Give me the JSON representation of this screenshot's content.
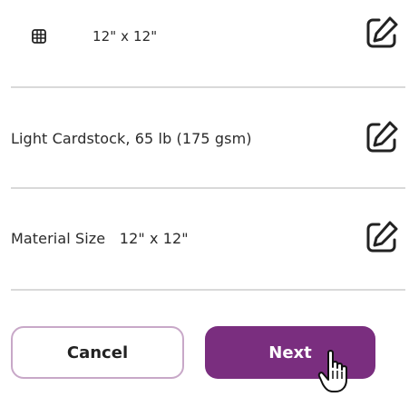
{
  "rows": [
    {
      "text": "12\" x 12\"",
      "icon": "grid-icon",
      "edit_icon": "edit-icon"
    },
    {
      "text": "Light Cardstock, 65 lb (175 gsm)",
      "edit_icon": "edit-icon"
    },
    {
      "text": "Material Size   12\" x 12\"",
      "edit_icon": "edit-icon"
    }
  ],
  "buttons": {
    "cancel_label": "Cancel",
    "next_label": "Next"
  },
  "colors": {
    "accent": "#7a2e7f",
    "cancel_border": "#c8a8c8",
    "divider": "#d9d9d9"
  },
  "cursor_icon": "hand-pointer-cursor"
}
